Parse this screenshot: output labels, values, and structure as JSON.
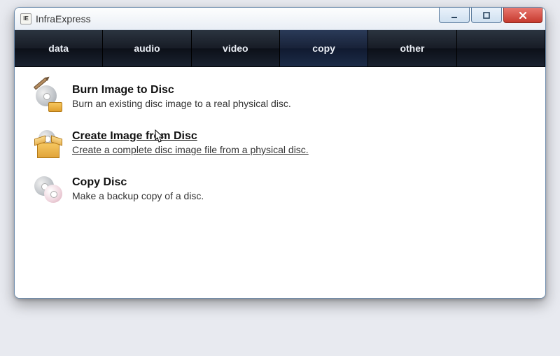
{
  "window": {
    "title": "InfraExpress"
  },
  "toolbar": {
    "tabs": [
      "data",
      "audio",
      "video",
      "copy",
      "other"
    ],
    "active_index": 3
  },
  "items": [
    {
      "title": "Burn Image to Disc",
      "desc": "Burn an existing disc image to a real physical disc."
    },
    {
      "title": "Create Image from Disc",
      "desc": "Create a complete disc image file from a physical disc."
    },
    {
      "title": "Copy Disc",
      "desc": "Make a backup copy of a disc."
    }
  ]
}
